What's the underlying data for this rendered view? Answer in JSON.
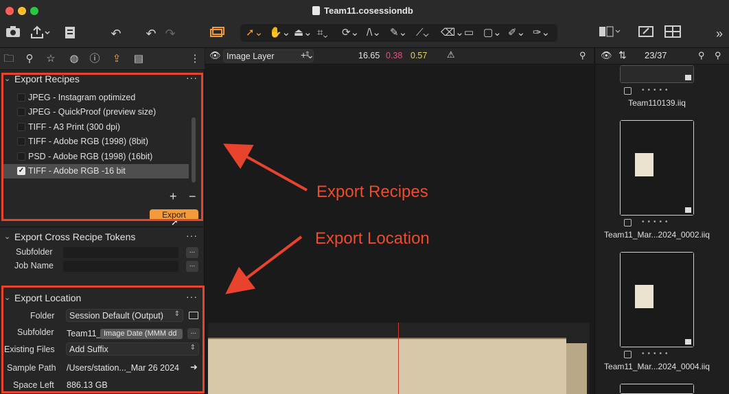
{
  "window": {
    "title": "Team11.cosessiondb"
  },
  "viewer": {
    "layer_label": "Image Layer",
    "value_1": "16.65",
    "value_2": "0.38",
    "value_3": "0.57",
    "value_2_color": "#e6508c",
    "value_3_color": "#e8d66a"
  },
  "browser": {
    "counter": "23/37"
  },
  "export_recipes": {
    "title": "Export Recipes",
    "items": [
      {
        "label": "JPEG - Instagram optimized",
        "checked": false
      },
      {
        "label": "JPEG - QuickProof (preview size)",
        "checked": false
      },
      {
        "label": "TIFF - A3 Print (300 dpi)",
        "checked": false
      },
      {
        "label": "TIFF - Adobe RGB (1998) (8bit)",
        "checked": false
      },
      {
        "label": "PSD - Adobe RGB (1998) (16bit)",
        "checked": false
      },
      {
        "label": "TIFF - Adobe RGB -16 bit",
        "checked": true
      }
    ],
    "plus": "+",
    "minus": "−",
    "export_button": "Export"
  },
  "cross_tokens": {
    "title": "Export Cross Recipe Tokens",
    "subfolder_label": "Subfolder",
    "jobname_label": "Job Name",
    "dots": "..."
  },
  "export_location": {
    "title": "Export Location",
    "folder_label": "Folder",
    "folder_value": "Session Default (Output)",
    "subfolder_label": "Subfolder",
    "subfolder_value": "Team11_",
    "subfolder_token": "Image Date (MMM dd",
    "existing_label": "Existing Files",
    "existing_value": "Add Suffix",
    "sample_label": "Sample Path",
    "sample_value": "/Users/station..._Mar 26 2024",
    "space_label": "Space Left",
    "space_value": "886.13 GB",
    "dots": "..."
  },
  "annotations": {
    "recipes": "Export Recipes",
    "location": "Export Location",
    "color": "#e8432d"
  },
  "thumbnails": [
    {
      "name": "Team110139.iiq"
    },
    {
      "name": "Team11_Mar...2024_0002.iiq"
    },
    {
      "name": "Team11_Mar...2024_0004.iiq"
    }
  ],
  "accent": "#f39a3a"
}
